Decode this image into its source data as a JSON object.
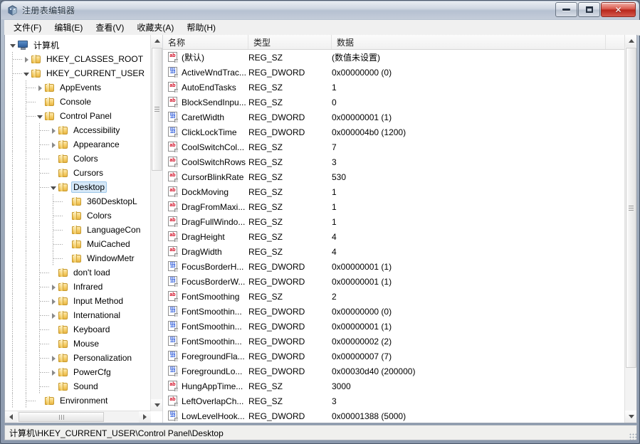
{
  "window": {
    "title": "注册表编辑器",
    "icon": "regedit-icon",
    "controls": {
      "minimize": "最小化",
      "maximize": "最大化",
      "close": "关闭"
    }
  },
  "menubar": {
    "items": [
      {
        "label": "文件(F)",
        "name": "menu-file"
      },
      {
        "label": "编辑(E)",
        "name": "menu-edit"
      },
      {
        "label": "查看(V)",
        "name": "menu-view"
      },
      {
        "label": "收藏夹(A)",
        "name": "menu-favorites"
      },
      {
        "label": "帮助(H)",
        "name": "menu-help"
      }
    ]
  },
  "tree": {
    "nodes": [
      {
        "label": "计算机",
        "level": 0,
        "icon": "computer-icon",
        "state": "open",
        "selected": false
      },
      {
        "label": "HKEY_CLASSES_ROOT",
        "level": 1,
        "icon": "folder-icon",
        "state": "closed",
        "selected": false
      },
      {
        "label": "HKEY_CURRENT_USER",
        "level": 1,
        "icon": "folder-icon",
        "state": "open",
        "selected": false
      },
      {
        "label": "AppEvents",
        "level": 2,
        "icon": "folder-icon",
        "state": "closed",
        "selected": false
      },
      {
        "label": "Console",
        "level": 2,
        "icon": "folder-icon",
        "state": "leaf",
        "selected": false
      },
      {
        "label": "Control Panel",
        "level": 2,
        "icon": "folder-icon",
        "state": "open",
        "selected": false
      },
      {
        "label": "Accessibility",
        "level": 3,
        "icon": "folder-icon",
        "state": "closed",
        "selected": false
      },
      {
        "label": "Appearance",
        "level": 3,
        "icon": "folder-icon",
        "state": "closed",
        "selected": false
      },
      {
        "label": "Colors",
        "level": 3,
        "icon": "folder-icon",
        "state": "leaf",
        "selected": false
      },
      {
        "label": "Cursors",
        "level": 3,
        "icon": "folder-icon",
        "state": "leaf",
        "selected": false
      },
      {
        "label": "Desktop",
        "level": 3,
        "icon": "folder-icon",
        "state": "open",
        "selected": true
      },
      {
        "label": "360DesktopL",
        "level": 4,
        "icon": "folder-icon",
        "state": "leaf",
        "selected": false
      },
      {
        "label": "Colors",
        "level": 4,
        "icon": "folder-icon",
        "state": "leaf",
        "selected": false
      },
      {
        "label": "LanguageCon",
        "level": 4,
        "icon": "folder-icon",
        "state": "leaf",
        "selected": false
      },
      {
        "label": "MuiCached",
        "level": 4,
        "icon": "folder-icon",
        "state": "leaf",
        "selected": false
      },
      {
        "label": "WindowMetr",
        "level": 4,
        "icon": "folder-icon",
        "state": "leaf",
        "selected": false
      },
      {
        "label": "don't load",
        "level": 3,
        "icon": "folder-icon",
        "state": "leaf",
        "selected": false
      },
      {
        "label": "Infrared",
        "level": 3,
        "icon": "folder-icon",
        "state": "closed",
        "selected": false
      },
      {
        "label": "Input Method",
        "level": 3,
        "icon": "folder-icon",
        "state": "closed",
        "selected": false
      },
      {
        "label": "International",
        "level": 3,
        "icon": "folder-icon",
        "state": "closed",
        "selected": false
      },
      {
        "label": "Keyboard",
        "level": 3,
        "icon": "folder-icon",
        "state": "leaf",
        "selected": false
      },
      {
        "label": "Mouse",
        "level": 3,
        "icon": "folder-icon",
        "state": "leaf",
        "selected": false
      },
      {
        "label": "Personalization",
        "level": 3,
        "icon": "folder-icon",
        "state": "closed",
        "selected": false
      },
      {
        "label": "PowerCfg",
        "level": 3,
        "icon": "folder-icon",
        "state": "closed",
        "selected": false
      },
      {
        "label": "Sound",
        "level": 3,
        "icon": "folder-icon",
        "state": "leaf",
        "selected": false
      },
      {
        "label": "Environment",
        "level": 2,
        "icon": "folder-icon",
        "state": "leaf",
        "selected": false
      }
    ]
  },
  "list": {
    "columns": [
      {
        "label": "名称",
        "name": "column-name"
      },
      {
        "label": "类型",
        "name": "column-type"
      },
      {
        "label": "数据",
        "name": "column-data"
      },
      {
        "label": "",
        "name": "column-filler"
      }
    ],
    "rows": [
      {
        "name": "(默认)",
        "type": "REG_SZ",
        "data": "(数值未设置)",
        "icon": "string-value-icon"
      },
      {
        "name": "ActiveWndTrac...",
        "type": "REG_DWORD",
        "data": "0x00000000 (0)",
        "icon": "dword-value-icon"
      },
      {
        "name": "AutoEndTasks",
        "type": "REG_SZ",
        "data": "1",
        "icon": "string-value-icon"
      },
      {
        "name": "BlockSendInpu...",
        "type": "REG_SZ",
        "data": "0",
        "icon": "string-value-icon"
      },
      {
        "name": "CaretWidth",
        "type": "REG_DWORD",
        "data": "0x00000001 (1)",
        "icon": "dword-value-icon"
      },
      {
        "name": "ClickLockTime",
        "type": "REG_DWORD",
        "data": "0x000004b0 (1200)",
        "icon": "dword-value-icon"
      },
      {
        "name": "CoolSwitchCol...",
        "type": "REG_SZ",
        "data": "7",
        "icon": "string-value-icon"
      },
      {
        "name": "CoolSwitchRows",
        "type": "REG_SZ",
        "data": "3",
        "icon": "string-value-icon"
      },
      {
        "name": "CursorBlinkRate",
        "type": "REG_SZ",
        "data": "530",
        "icon": "string-value-icon"
      },
      {
        "name": "DockMoving",
        "type": "REG_SZ",
        "data": "1",
        "icon": "string-value-icon"
      },
      {
        "name": "DragFromMaxi...",
        "type": "REG_SZ",
        "data": "1",
        "icon": "string-value-icon"
      },
      {
        "name": "DragFullWindo...",
        "type": "REG_SZ",
        "data": "1",
        "icon": "string-value-icon"
      },
      {
        "name": "DragHeight",
        "type": "REG_SZ",
        "data": "4",
        "icon": "string-value-icon"
      },
      {
        "name": "DragWidth",
        "type": "REG_SZ",
        "data": "4",
        "icon": "string-value-icon"
      },
      {
        "name": "FocusBorderH...",
        "type": "REG_DWORD",
        "data": "0x00000001 (1)",
        "icon": "dword-value-icon"
      },
      {
        "name": "FocusBorderW...",
        "type": "REG_DWORD",
        "data": "0x00000001 (1)",
        "icon": "dword-value-icon"
      },
      {
        "name": "FontSmoothing",
        "type": "REG_SZ",
        "data": "2",
        "icon": "string-value-icon"
      },
      {
        "name": "FontSmoothin...",
        "type": "REG_DWORD",
        "data": "0x00000000 (0)",
        "icon": "dword-value-icon"
      },
      {
        "name": "FontSmoothin...",
        "type": "REG_DWORD",
        "data": "0x00000001 (1)",
        "icon": "dword-value-icon"
      },
      {
        "name": "FontSmoothin...",
        "type": "REG_DWORD",
        "data": "0x00000002 (2)",
        "icon": "dword-value-icon"
      },
      {
        "name": "ForegroundFla...",
        "type": "REG_DWORD",
        "data": "0x00000007 (7)",
        "icon": "dword-value-icon"
      },
      {
        "name": "ForegroundLo...",
        "type": "REG_DWORD",
        "data": "0x00030d40 (200000)",
        "icon": "dword-value-icon"
      },
      {
        "name": "HungAppTime...",
        "type": "REG_SZ",
        "data": "3000",
        "icon": "string-value-icon"
      },
      {
        "name": "LeftOverlapCh...",
        "type": "REG_SZ",
        "data": "3",
        "icon": "string-value-icon"
      },
      {
        "name": "LowLevelHook...",
        "type": "REG_DWORD",
        "data": "0x00001388 (5000)",
        "icon": "dword-value-icon"
      }
    ]
  },
  "statusbar": {
    "path": "计算机\\HKEY_CURRENT_USER\\Control Panel\\Desktop"
  },
  "icons": {
    "string_glyph": "ab",
    "dword_glyph_top": "011",
    "dword_glyph_bottom": "110"
  },
  "colors": {
    "selection": "#d6e8f7",
    "selection_border": "#9cc6e8",
    "string_icon": "#d0021b",
    "dword_icon": "#1d4ed8",
    "close_button": "#b8271c"
  }
}
